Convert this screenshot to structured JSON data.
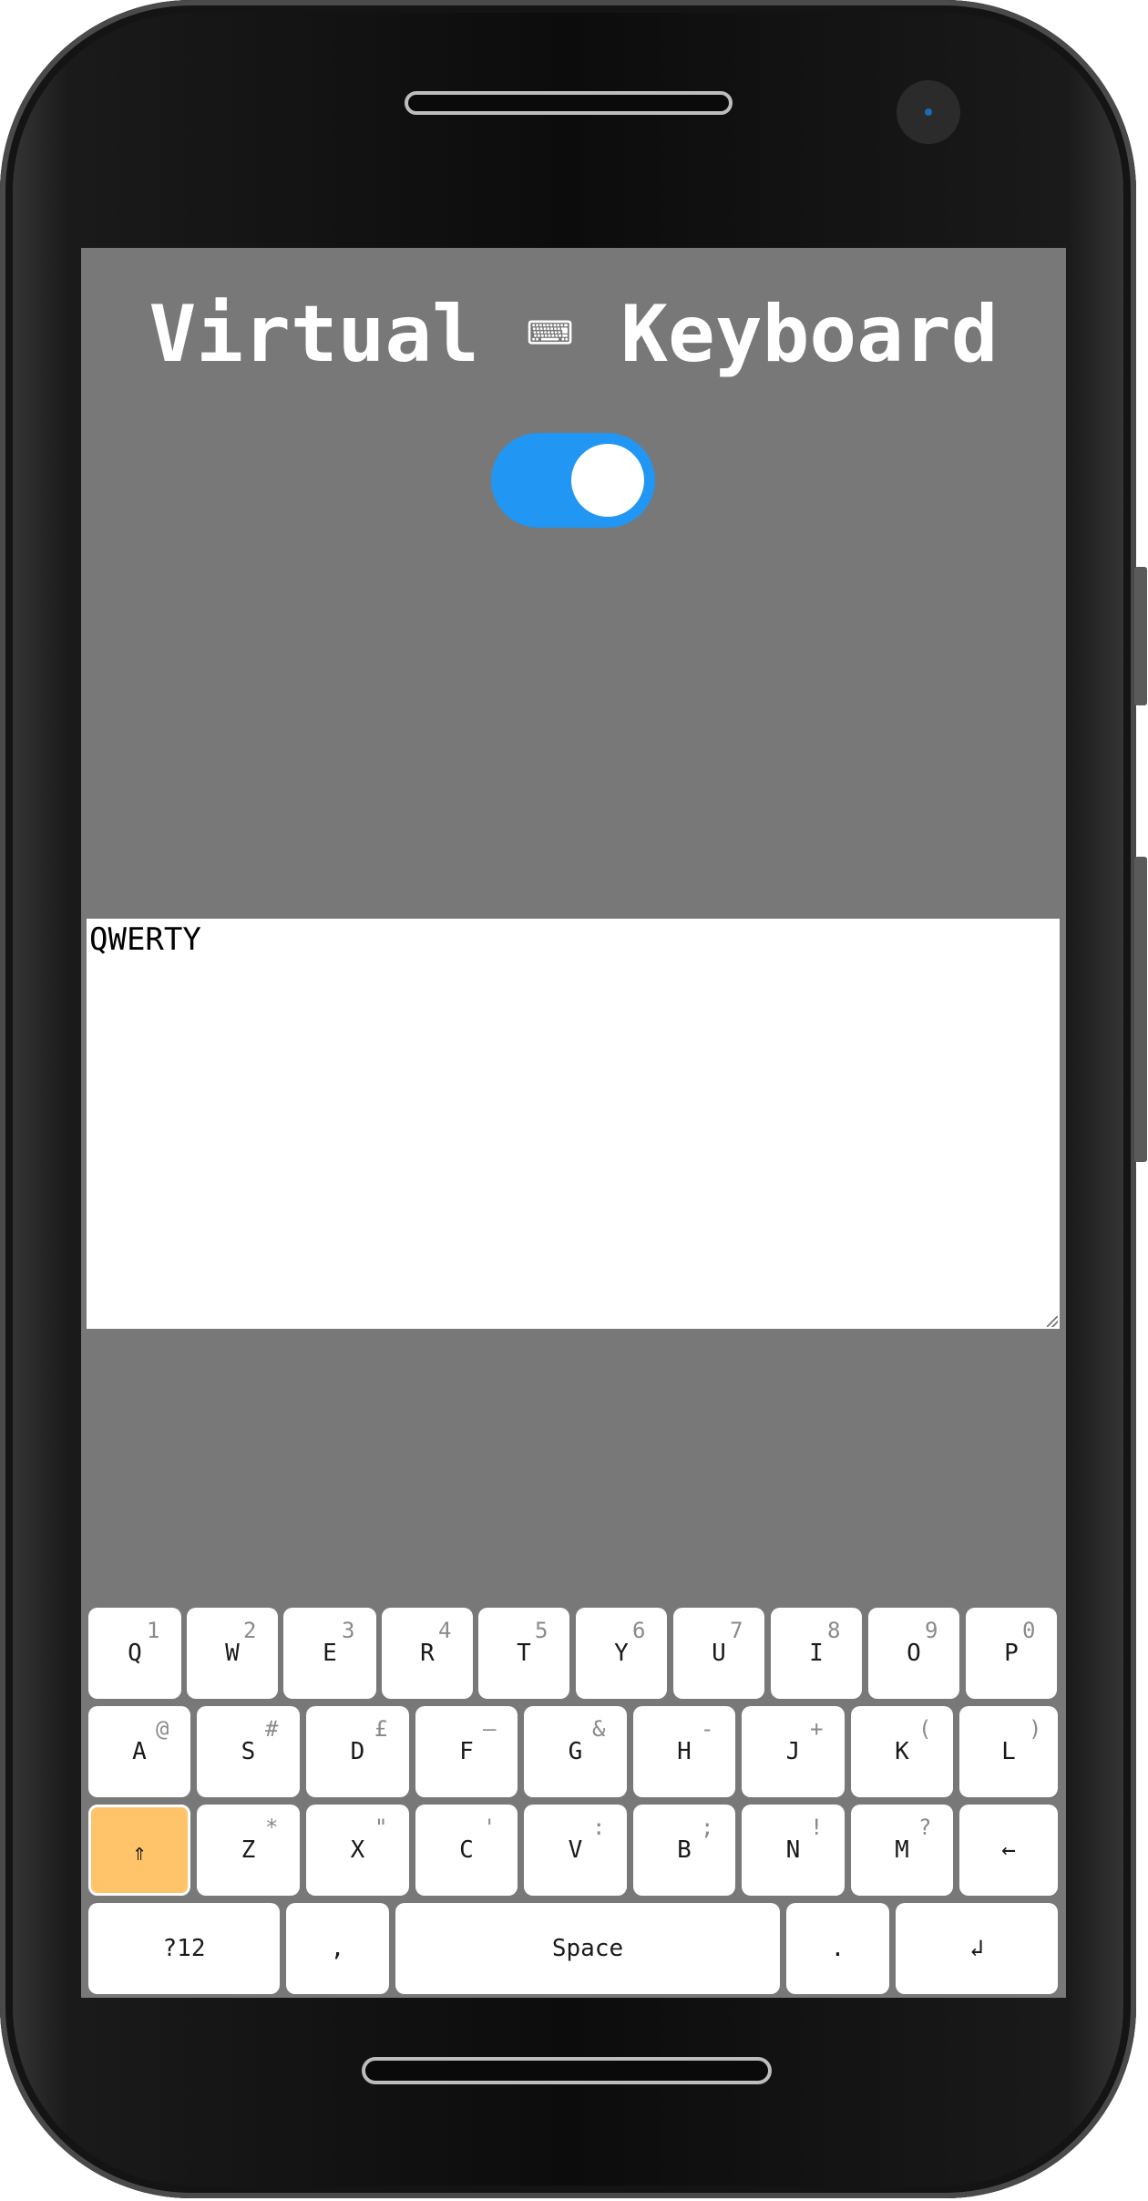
{
  "app": {
    "title": "Virtual ⌨ Keyboard",
    "toggle_on": true,
    "toggle_color": "#2196f3"
  },
  "textarea": {
    "value": "QWERTY"
  },
  "keyboard": {
    "row1": [
      {
        "label": "Q",
        "alt": "1"
      },
      {
        "label": "W",
        "alt": "2"
      },
      {
        "label": "E",
        "alt": "3"
      },
      {
        "label": "R",
        "alt": "4"
      },
      {
        "label": "T",
        "alt": "5"
      },
      {
        "label": "Y",
        "alt": "6"
      },
      {
        "label": "U",
        "alt": "7"
      },
      {
        "label": "I",
        "alt": "8"
      },
      {
        "label": "O",
        "alt": "9"
      },
      {
        "label": "P",
        "alt": "0"
      }
    ],
    "row2": [
      {
        "label": "A",
        "alt": "@"
      },
      {
        "label": "S",
        "alt": "#"
      },
      {
        "label": "D",
        "alt": "£"
      },
      {
        "label": "F",
        "alt": "—"
      },
      {
        "label": "G",
        "alt": "&"
      },
      {
        "label": "H",
        "alt": "-"
      },
      {
        "label": "J",
        "alt": "+"
      },
      {
        "label": "K",
        "alt": "("
      },
      {
        "label": "L",
        "alt": ")"
      }
    ],
    "row3": [
      {
        "label": "⇑",
        "alt": ""
      },
      {
        "label": "Z",
        "alt": "*"
      },
      {
        "label": "X",
        "alt": "\""
      },
      {
        "label": "C",
        "alt": "'"
      },
      {
        "label": "V",
        "alt": ":"
      },
      {
        "label": "B",
        "alt": ";"
      },
      {
        "label": "N",
        "alt": "!"
      },
      {
        "label": "M",
        "alt": "?"
      },
      {
        "label": "←",
        "alt": ""
      }
    ],
    "row4": [
      {
        "label": "?12",
        "alt": ""
      },
      {
        "label": ",",
        "alt": ""
      },
      {
        "label": "Space",
        "alt": ""
      },
      {
        "label": ".",
        "alt": ""
      },
      {
        "label": "↲",
        "alt": ""
      }
    ],
    "shift_active_color": "#ffc36a"
  }
}
